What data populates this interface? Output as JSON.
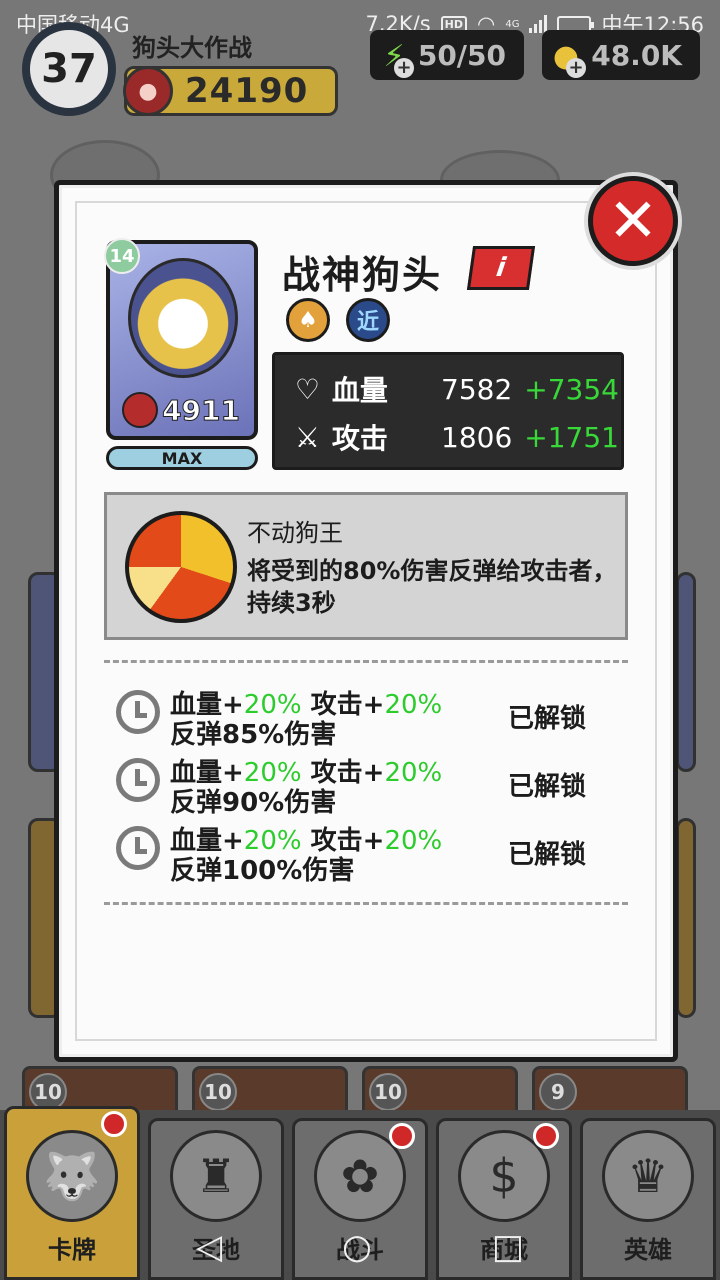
{
  "status_bar": {
    "carrier": "中国移动4G",
    "speed": "7.2K/s",
    "hd": "HD",
    "network": "4G",
    "time": "中午12:56"
  },
  "hud": {
    "level": "37",
    "game_title": "狗头大作战",
    "trophies": "24190",
    "energy": "50/50",
    "coins": "48.0K"
  },
  "hero": {
    "card_level": "14",
    "power": "4911",
    "max_label": "MAX",
    "name": "战神狗头",
    "info_icon": "i",
    "melee_tag": "近",
    "stats": [
      {
        "icon": "heart-icon",
        "label": "血量",
        "value": "7582",
        "bonus": "+7354"
      },
      {
        "icon": "sword-icon",
        "label": "攻击",
        "value": "1806",
        "bonus": "+1751"
      }
    ]
  },
  "skill": {
    "name": "不动狗王",
    "description": "将受到的80%伤害反弹给攻击者，持续3秒"
  },
  "unlocks": [
    {
      "hp_label": "血量+",
      "hp_bonus": "20%",
      "atk_label": " 攻击+",
      "atk_bonus": "20%",
      "effect": "反弹85%伤害",
      "status": "已解锁"
    },
    {
      "hp_label": "血量+",
      "hp_bonus": "20%",
      "atk_label": " 攻击+",
      "atk_bonus": "20%",
      "effect": "反弹90%伤害",
      "status": "已解锁"
    },
    {
      "hp_label": "血量+",
      "hp_bonus": "20%",
      "atk_label": " 攻击+",
      "atk_bonus": "20%",
      "effect": "反弹100%伤害",
      "status": "已解锁"
    }
  ],
  "background_cards": [
    "10",
    "10",
    "10",
    "9"
  ],
  "nav": [
    {
      "label": "卡牌",
      "active": true,
      "dot": true
    },
    {
      "label": "圣地",
      "active": false,
      "dot": false
    },
    {
      "label": "战斗",
      "active": false,
      "dot": true
    },
    {
      "label": "商城",
      "active": false,
      "dot": true
    },
    {
      "label": "英雄",
      "active": false,
      "dot": false
    }
  ],
  "colors": {
    "close_red": "#d42a2a",
    "bonus_green": "#38d838",
    "unlock_green": "#2ccc2c"
  }
}
